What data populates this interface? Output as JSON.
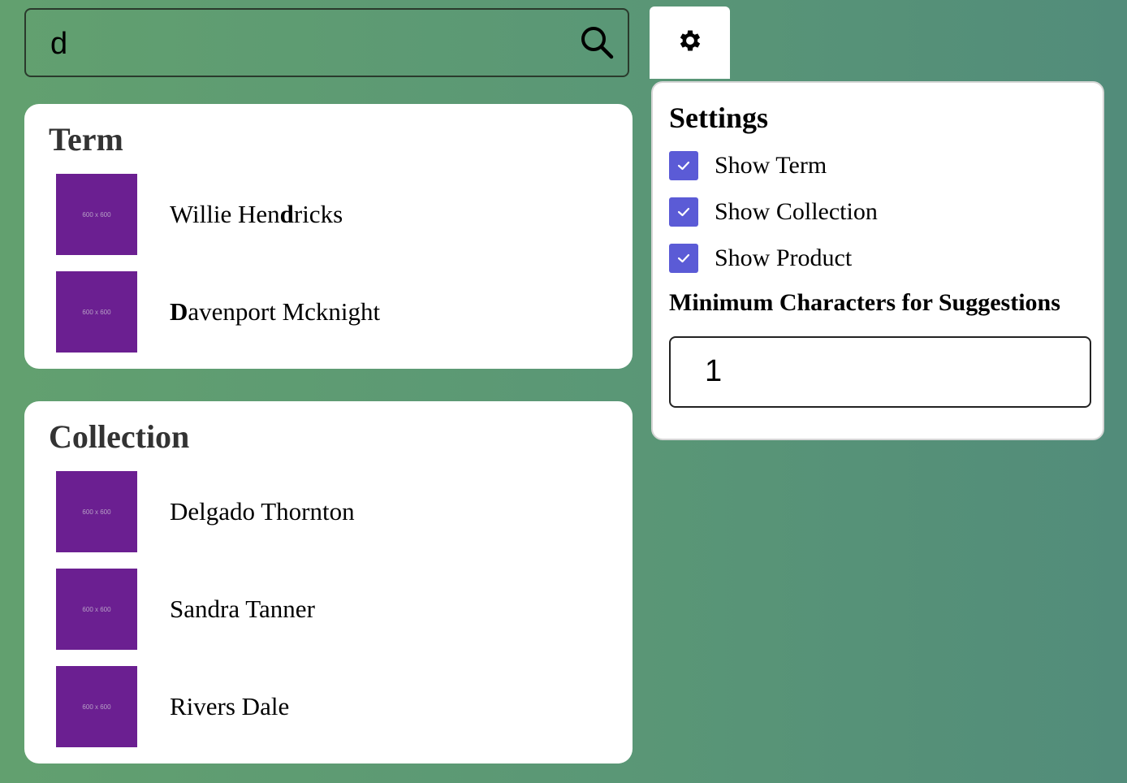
{
  "search": {
    "value": "d"
  },
  "term_section": {
    "title": "Term",
    "items": [
      {
        "thumb": "600 x 600",
        "pre": "Willie Hen",
        "hl": "d",
        "post": "ricks"
      },
      {
        "thumb": "600 x 600",
        "pre": "",
        "hl": "D",
        "post": "avenport Mcknight"
      }
    ]
  },
  "collection_section": {
    "title": "Collection",
    "items": [
      {
        "thumb": "600 x 600",
        "name": "Delgado Thornton"
      },
      {
        "thumb": "600 x 600",
        "name": "Sandra Tanner"
      },
      {
        "thumb": "600 x 600",
        "name": "Rivers Dale"
      }
    ]
  },
  "settings": {
    "title": "Settings",
    "options": [
      {
        "label": "Show Term",
        "checked": true
      },
      {
        "label": "Show Collection",
        "checked": true
      },
      {
        "label": "Show Product",
        "checked": true
      }
    ],
    "min_chars_label": "Minimum Characters for Suggestions",
    "min_chars_value": "1"
  },
  "colors": {
    "accent": "#5b5bd6",
    "thumb": "#6b1f91"
  },
  "icons": {
    "search": "search-icon",
    "settings": "gear-icon",
    "check": "check-icon"
  }
}
